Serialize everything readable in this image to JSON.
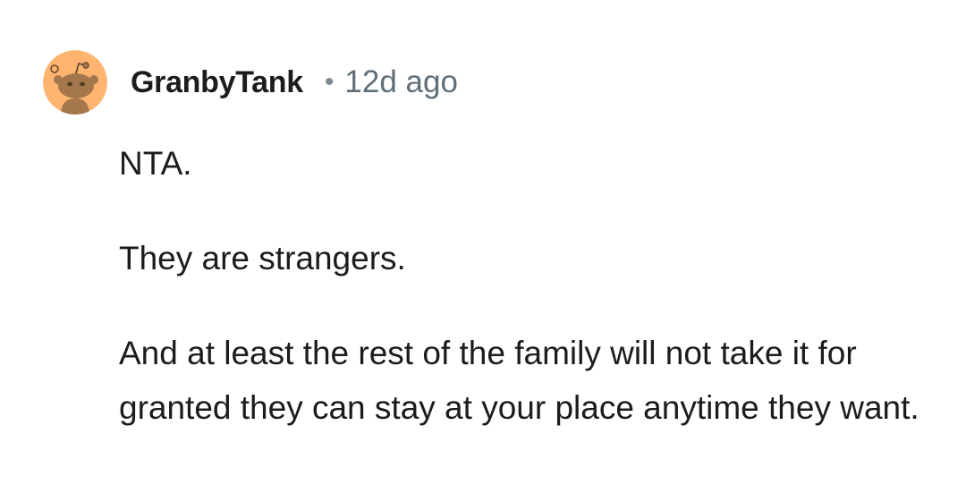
{
  "comment": {
    "author": "GranbyTank",
    "separator": "•",
    "timestamp": "12d ago",
    "avatar_icon": "reddit-snoo-avatar-icon",
    "paragraphs": [
      "NTA.",
      "They are strangers.",
      "And at least the rest of the family will not take it for granted they can stay at your place anytime they want."
    ]
  },
  "colors": {
    "avatar_bg": "#FFB470",
    "avatar_figure": "#A5774C",
    "username": "#1C1C1C",
    "meta": "#5F6F79",
    "body_text": "#1C1C1C"
  }
}
